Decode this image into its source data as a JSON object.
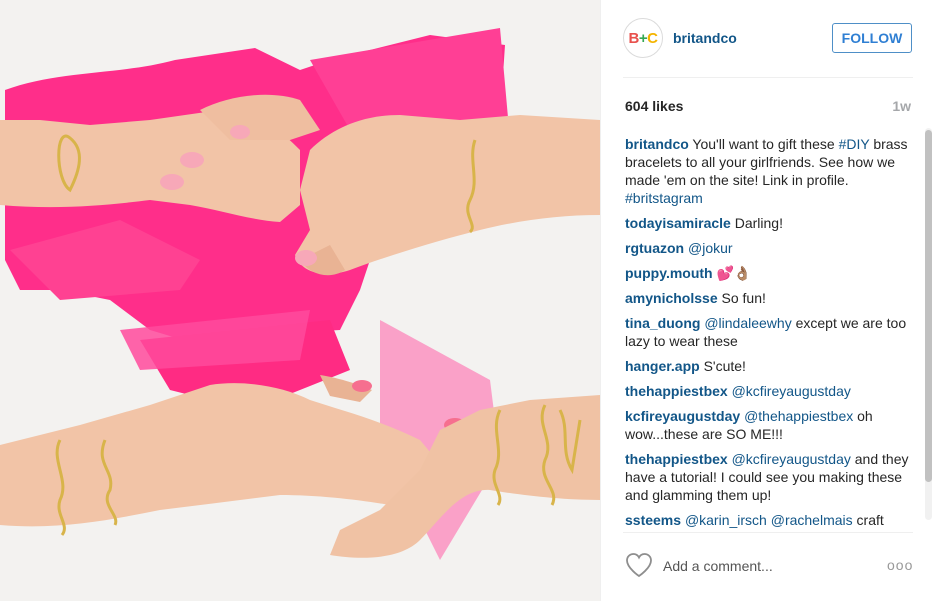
{
  "post": {
    "image": {
      "description_icon": "photo",
      "accent_colors": {
        "background": "#f3f2f0",
        "paint": "#ff2e8a",
        "paint_light": "#ff5fa8",
        "skin": "#f2c4a7",
        "skin_shadow": "#e2a98a",
        "nail": "#f66f8f",
        "brass": "#d8b44a"
      }
    }
  },
  "header": {
    "avatar_letters": [
      "B",
      "+",
      "C"
    ],
    "username": "britandco",
    "follow_label": "FOLLOW"
  },
  "stats": {
    "likes": "604 likes",
    "age": "1w"
  },
  "comments": [
    {
      "user": "britandco",
      "parts": [
        {
          "t": " You'll want to gift these ",
          "tag": false
        },
        {
          "t": "#DIY",
          "tag": true
        },
        {
          "t": " brass bracelets to all your girlfriends. See how we made 'em on the site! Link in profile. ",
          "tag": false
        },
        {
          "t": "#britstagram",
          "tag": true
        }
      ]
    },
    {
      "user": "todayisamiracle",
      "parts": [
        {
          "t": " Darling!",
          "tag": false
        }
      ]
    },
    {
      "user": "rgtuazon",
      "parts": [
        {
          "t": " ",
          "tag": false
        },
        {
          "t": "@jokur",
          "tag": true
        }
      ]
    },
    {
      "user": "puppy.mouth",
      "parts": [
        {
          "t": " 💕👌🏽",
          "tag": false
        }
      ]
    },
    {
      "user": "amynicholsse",
      "parts": [
        {
          "t": " So fun!",
          "tag": false
        }
      ]
    },
    {
      "user": "tina_duong",
      "parts": [
        {
          "t": " ",
          "tag": false
        },
        {
          "t": "@lindaleewhy",
          "tag": true
        },
        {
          "t": " except we are too lazy to wear these",
          "tag": false
        }
      ]
    },
    {
      "user": "hanger.app",
      "parts": [
        {
          "t": " S'cute!",
          "tag": false
        }
      ]
    },
    {
      "user": "thehappiestbex",
      "parts": [
        {
          "t": " ",
          "tag": false
        },
        {
          "t": "@kcfireyaugustday",
          "tag": true
        }
      ]
    },
    {
      "user": "kcfireyaugustday",
      "parts": [
        {
          "t": " ",
          "tag": false
        },
        {
          "t": "@thehappiestbex",
          "tag": true
        },
        {
          "t": " oh wow...these are SO ME!!!",
          "tag": false
        }
      ]
    },
    {
      "user": "thehappiestbex",
      "parts": [
        {
          "t": " ",
          "tag": false
        },
        {
          "t": "@kcfireyaugustday",
          "tag": true
        },
        {
          "t": " and they have a tutorial! I could see you making these and glamming them up!",
          "tag": false
        }
      ]
    },
    {
      "user": "ssteems",
      "parts": [
        {
          "t": " ",
          "tag": false
        },
        {
          "t": "@karin_irsch",
          "tag": true
        },
        {
          "t": " ",
          "tag": false
        },
        {
          "t": "@rachelmais",
          "tag": true
        },
        {
          "t": " craft",
          "tag": false
        }
      ]
    }
  ],
  "footer": {
    "heart_icon": "heart-outline",
    "comment_placeholder": "Add a comment...",
    "more_label": "ooo"
  }
}
